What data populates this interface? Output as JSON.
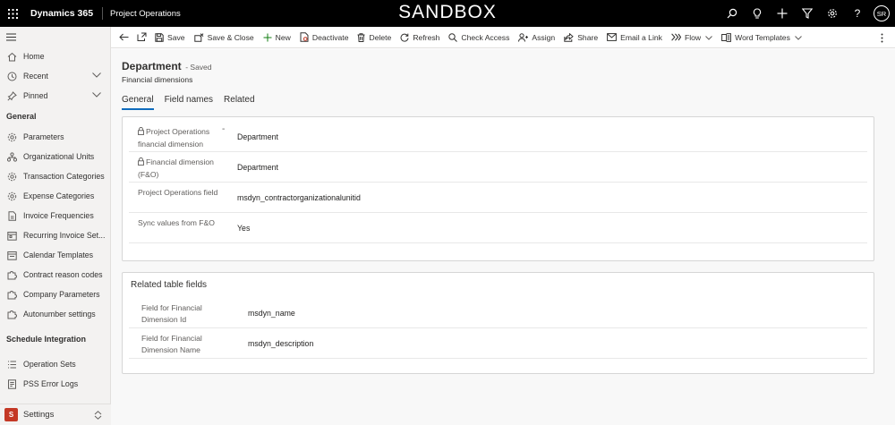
{
  "topbar": {
    "brand": "Dynamics 365",
    "app": "Project Operations",
    "environment": "SANDBOX",
    "avatar_initials": "SR",
    "icons": [
      "search-icon",
      "lightbulb-icon",
      "plus-icon",
      "filter-icon",
      "gear-icon",
      "help-icon"
    ]
  },
  "sidebar": {
    "top_items": [
      {
        "label": "Home",
        "icon": "home-icon"
      },
      {
        "label": "Recent",
        "icon": "clock-icon"
      },
      {
        "label": "Pinned",
        "icon": "pin-icon"
      }
    ],
    "group1": "General",
    "items": [
      {
        "label": "Parameters",
        "icon": "gear-icon"
      },
      {
        "label": "Organizational Units",
        "icon": "org-icon"
      },
      {
        "label": "Transaction Categories",
        "icon": "gear-icon"
      },
      {
        "label": "Expense Categories",
        "icon": "gear-icon"
      },
      {
        "label": "Invoice Frequencies",
        "icon": "document-icon"
      },
      {
        "label": "Recurring Invoice Set...",
        "icon": "calendar-icon"
      },
      {
        "label": "Calendar Templates",
        "icon": "calendar-icon"
      },
      {
        "label": "Contract reason codes",
        "icon": "puzzle-icon"
      },
      {
        "label": "Company Parameters",
        "icon": "puzzle-icon"
      },
      {
        "label": "Autonumber settings",
        "icon": "puzzle-icon"
      }
    ],
    "group2": "Schedule Integration",
    "items2": [
      {
        "label": "Operation Sets",
        "icon": "list-icon"
      },
      {
        "label": "PSS Error Logs",
        "icon": "log-icon"
      }
    ],
    "area": {
      "badge": "S",
      "label": "Settings"
    }
  },
  "commands": {
    "save": "Save",
    "save_close": "Save & Close",
    "new": "New",
    "deactivate": "Deactivate",
    "delete": "Delete",
    "refresh": "Refresh",
    "check_access": "Check Access",
    "assign": "Assign",
    "share": "Share",
    "email_link": "Email a Link",
    "flow": "Flow",
    "word_templates": "Word Templates"
  },
  "record": {
    "title": "Department",
    "status": "- Saved",
    "entity": "Financial dimensions"
  },
  "tabs": [
    "General",
    "Field names",
    "Related"
  ],
  "general_fields": [
    {
      "label": "Project Operations financial dimension",
      "value": "Department",
      "locked": true,
      "required": "-"
    },
    {
      "label": "Financial dimension (F&O)",
      "value": "Department",
      "locked": true
    },
    {
      "label": "Project Operations field",
      "value": "msdyn_contractorganizationalunitid",
      "locked": false
    },
    {
      "label": "Sync values from F&O",
      "value": "Yes",
      "locked": false
    }
  ],
  "related_section": {
    "title": "Related table fields",
    "fields": [
      {
        "label": "Field for Financial Dimension Id",
        "value": "msdyn_name"
      },
      {
        "label": "Field for Financial Dimension Name",
        "value": "msdyn_description"
      }
    ]
  },
  "colors": {
    "topbar": "#000000",
    "sidebar": "#f3f2f1",
    "accent": "#0f6cbd",
    "area_badge": "#c43825"
  }
}
